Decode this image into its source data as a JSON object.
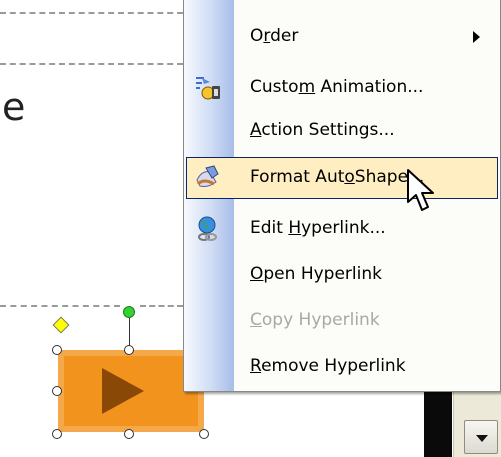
{
  "slide": {
    "text_fragment": "e"
  },
  "context_menu": {
    "items": [
      {
        "before": "O",
        "key": "r",
        "after": "der",
        "has_submenu": true,
        "icon": "none"
      },
      {
        "before": "Custo",
        "key": "m",
        "after": " Animation...",
        "icon": "custom-animation-icon"
      },
      {
        "before": "",
        "key": "A",
        "after": "ction Settings...",
        "icon": "none"
      },
      {
        "before": "Format Aut",
        "key": "o",
        "after": "Shape...",
        "icon": "format-autoshape-icon",
        "highlighted": true
      },
      {
        "before": "Edit ",
        "key": "H",
        "after": "yperlink...",
        "icon": "edit-hyperlink-icon"
      },
      {
        "before": "",
        "key": "O",
        "after": "pen Hyperlink",
        "icon": "none"
      },
      {
        "before": "",
        "key": "C",
        "after": "opy Hyperlink",
        "icon": "none",
        "disabled": true
      },
      {
        "before": "",
        "key": "R",
        "after": "emove Hyperlink",
        "icon": "none"
      }
    ]
  },
  "colors": {
    "shape_fill": "#f2931e",
    "shape_play": "#8a4806",
    "menu_highlight": "#ffeec2",
    "menu_highlight_border": "#0a246a",
    "rotate_handle": "#34d134",
    "adjust_handle": "#ffff00"
  }
}
